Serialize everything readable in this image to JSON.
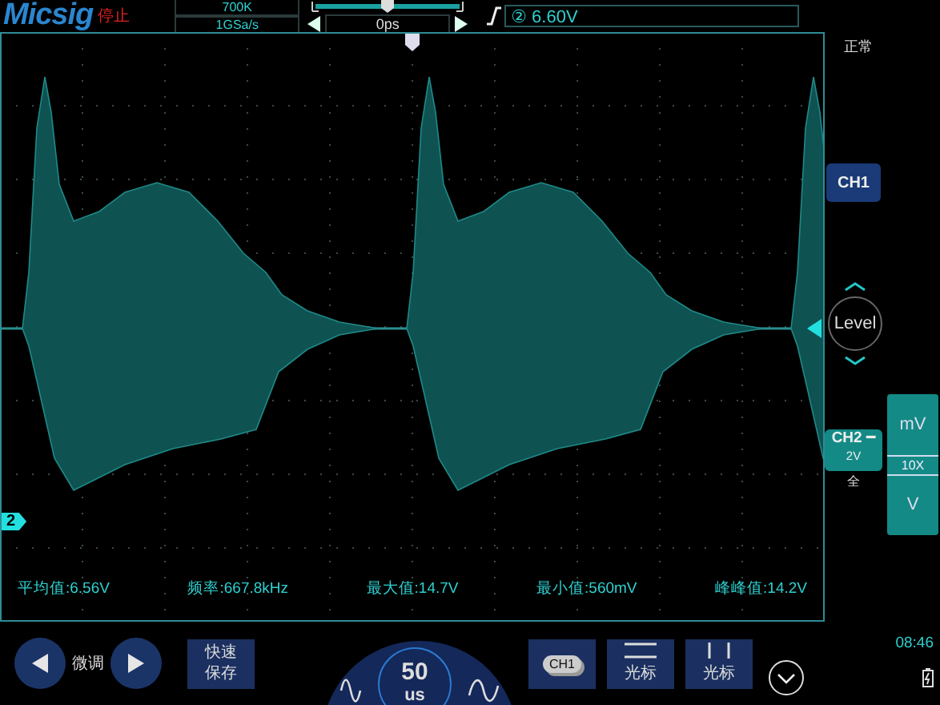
{
  "brand": {
    "logo": "Micsig",
    "run_state": "停止"
  },
  "acquisition": {
    "memory_depth": "700K",
    "sample_rate": "1GSa/s"
  },
  "horizontal_position": {
    "offset": "0ps"
  },
  "trigger": {
    "level": "② 6.60V",
    "mode": "正常"
  },
  "channel_marker": "2",
  "measurements": [
    "平均值:6.56V",
    "频率:667.8kHz",
    "最大值:14.7V",
    "最小值:560mV",
    "峰峰值:14.2V"
  ],
  "right_panel": {
    "ch1_button": "CH1",
    "level_knob": "Level",
    "ch2": {
      "label": "CH2 ━",
      "scale": "2V",
      "bandwidth": "全"
    },
    "units": {
      "upper": "mV",
      "probe": "10X",
      "lower": "V"
    }
  },
  "bottom_bar": {
    "fine_tune": "微调",
    "quick_save": "快速保存",
    "timebase_value": "50",
    "timebase_unit": "us",
    "channel_chip": "CH1",
    "cursor_buttons": [
      {
        "kind": "horizontal",
        "label": "光标"
      },
      {
        "kind": "vertical",
        "label": "光标"
      }
    ],
    "clock": "08:46"
  }
}
